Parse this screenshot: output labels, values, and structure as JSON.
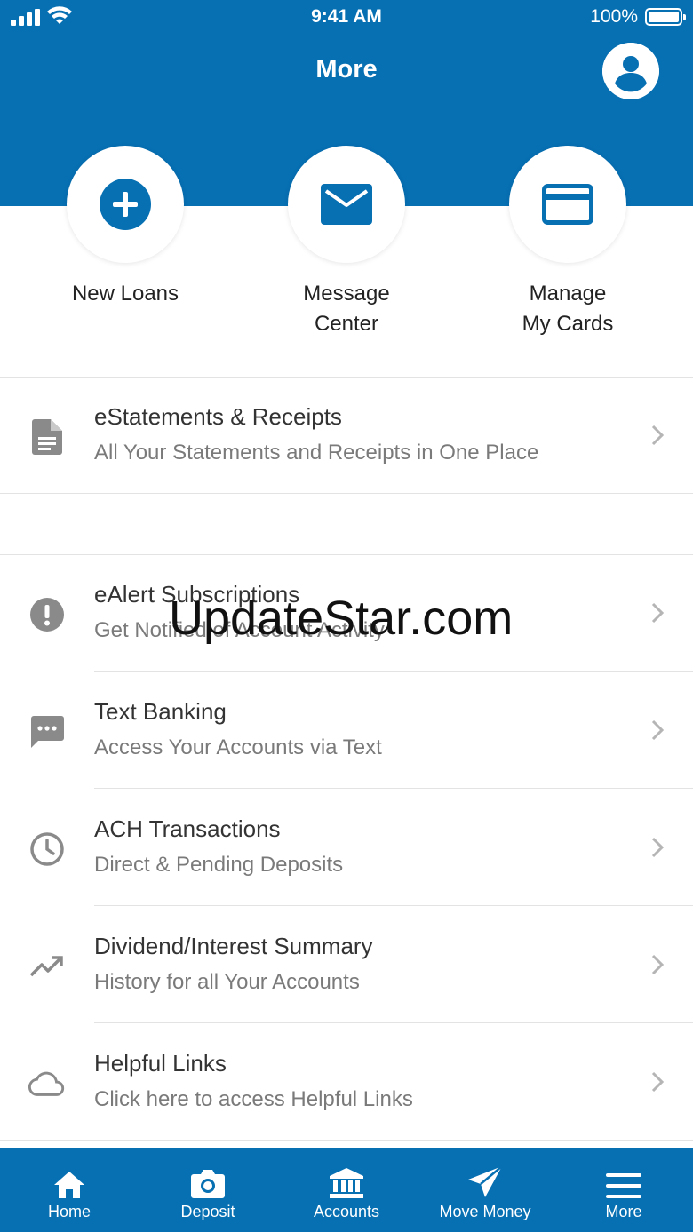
{
  "status_bar": {
    "time": "9:41 AM",
    "battery": "100%"
  },
  "header": {
    "title": "More"
  },
  "quick_actions": [
    {
      "label": "New Loans",
      "icon": "plus-circle-icon"
    },
    {
      "label": "Message\nCenter",
      "icon": "envelope-icon"
    },
    {
      "label": "Manage\nMy Cards",
      "icon": "credit-card-icon"
    }
  ],
  "menu": [
    {
      "title": "eStatements & Receipts",
      "subtitle": "All Your Statements and Receipts in One Place",
      "icon": "document-icon"
    },
    {
      "title": "eAlert Subscriptions",
      "subtitle": "Get Notified of Account Activity",
      "icon": "alert-icon"
    },
    {
      "title": "Text Banking",
      "subtitle": "Access Your Accounts via Text",
      "icon": "chat-icon"
    },
    {
      "title": "ACH Transactions",
      "subtitle": "Direct & Pending Deposits",
      "icon": "clock-icon"
    },
    {
      "title": "Dividend/Interest Summary",
      "subtitle": "History for all Your Accounts",
      "icon": "trending-up-icon"
    },
    {
      "title": "Helpful Links",
      "subtitle": "Click here to access Helpful Links",
      "icon": "cloud-icon"
    }
  ],
  "watermark": "UpdateStar.com",
  "tabs": [
    {
      "label": "Home",
      "icon": "home-icon"
    },
    {
      "label": "Deposit",
      "icon": "camera-icon"
    },
    {
      "label": "Accounts",
      "icon": "bank-icon"
    },
    {
      "label": "Move Money",
      "icon": "send-icon"
    },
    {
      "label": "More",
      "icon": "menu-icon"
    }
  ],
  "colors": {
    "brand": "#0770b3",
    "icon_gray": "#8a8a8a",
    "text": "#333333",
    "subtext": "#7a7a7a"
  }
}
